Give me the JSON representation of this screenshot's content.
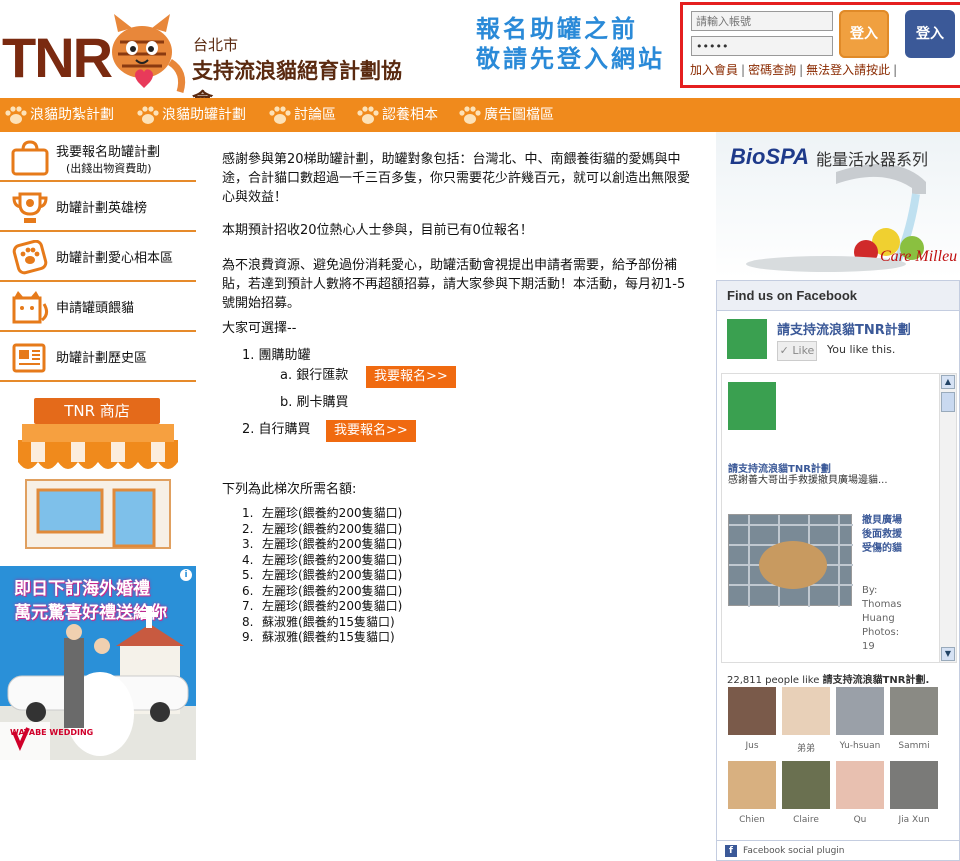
{
  "header": {
    "logo_text": "TNR",
    "city": "台北市",
    "org_name": "支持流浪貓絕育計劃協會",
    "slogan_line1": "報名助罐之前",
    "slogan_line2": "敬請先登入網站"
  },
  "login": {
    "account_placeholder": "請輸入帳號",
    "password_value": "•••••",
    "login_label": "登入",
    "fb_login_label": "登入",
    "links": [
      "加入會員",
      "密碼查詢",
      "無法登入請按此"
    ]
  },
  "nav": {
    "items": [
      "浪貓助紮計劃",
      "浪貓助罐計劃",
      "討論區",
      "認養相本",
      "廣告圖檔區"
    ]
  },
  "sidebar": {
    "items": [
      {
        "label": "我要報名助罐計劃",
        "sub": "(出錢出物資費助)"
      },
      {
        "label": "助罐計劃英雄榜"
      },
      {
        "label": "助罐計劃愛心相本區"
      },
      {
        "label": "申請罐頭餵貓"
      },
      {
        "label": "助罐計劃歷史區"
      }
    ],
    "shop_title": "TNR 商店",
    "ad_line1": "即日下訂海外婚禮",
    "ad_line2": "萬元驚喜好禮送給你",
    "ad_brand": "WATABE WEDDING"
  },
  "main": {
    "intro": "感謝參與第20梯助罐計劃，助罐對象包括：台灣北、中、南餵養街貓的愛媽與中途，合計貓口數超過一千三百多隻，你只需要花少許幾百元，就可以創造出無限愛心與效益！",
    "recruit": "本期預計招收20位熱心人士參與，目前已有0位報名！",
    "notice": "為不浪費資源、避免過份消耗愛心，助罐活動會視提出申請者需要，給予部份補貼，若達到預計人數將不再超額招募，請大家參與下期活動！本活動，每月初1-5號開始招募。",
    "choose": "大家可選擇--",
    "option1": "團購助罐",
    "option1_num": "1.",
    "option1a": "銀行匯款",
    "option1a_num": "a.",
    "option1b": "刷卡購買",
    "option1b_num": "b.",
    "option2": "自行購買",
    "option2_num": "2.",
    "signup_label": "我要報名>>",
    "quota_title": "下列為此梯次所需名額:",
    "quota": [
      "左麗珍(餵養約200隻貓口)",
      "左麗珍(餵養約200隻貓口)",
      "左麗珍(餵養約200隻貓口)",
      "左麗珍(餵養約200隻貓口)",
      "左麗珍(餵養約200隻貓口)",
      "左麗珍(餵養約200隻貓口)",
      "左麗珍(餵養約200隻貓口)",
      "蘇淑雅(餵養約15隻貓口)",
      "蘇淑雅(餵養約15隻貓口)"
    ]
  },
  "right": {
    "ad_brand": "BioSPA",
    "ad_tagline": "能量活水器系列",
    "ad_brand2": "Care Milleu",
    "fb_header": "Find us on Facebook",
    "fb_page_name": "請支持流浪貓TNR計劃",
    "fb_like": "Like",
    "fb_likes_this": "You like this.",
    "post_title": "請支持流浪貓TNR計劃",
    "post_body": "感謝善大哥出手救援撤貝廣場邊貓...",
    "post_link": "撤貝廣場後面救援受傷的貓",
    "post_author": "By: Thomas Huang Photos: 19",
    "fb_count_num": "22,811 people like",
    "fb_count_page": "請支持流浪貓TNR計劃.",
    "fans": [
      "Jus",
      "弟弟",
      "Yu-hsuan",
      "Sammi",
      "Chien",
      "Claire",
      "Qu",
      "Jia Xun"
    ],
    "fb_footer": "Facebook social plugin",
    "fb_icon": "f"
  },
  "colors": {
    "nav_orange": "#f08a1c",
    "login_border_red": "#e51f1f",
    "button_orange": "#f06a10",
    "slogan_blue": "#2a8ad8",
    "facebook_blue": "#3b5998"
  }
}
